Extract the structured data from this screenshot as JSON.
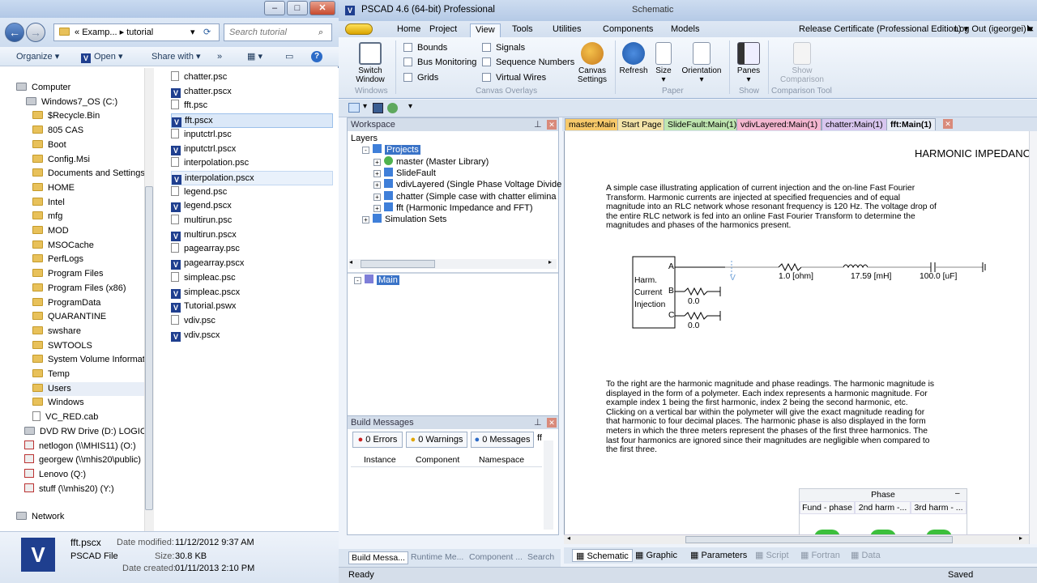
{
  "explorer": {
    "address": {
      "seg1": "Examp...",
      "seg2": "tutorial"
    },
    "search_placeholder": "Search tutorial",
    "commands": {
      "organize": "Organize",
      "open": "Open",
      "share_with": "Share with",
      "more": "»"
    },
    "nav": [
      {
        "label": "Computer",
        "kind": "computer"
      },
      {
        "label": "Windows7_OS (C:)",
        "kind": "drive"
      },
      {
        "label": "$Recycle.Bin",
        "kind": "folder"
      },
      {
        "label": "805 CAS",
        "kind": "folder"
      },
      {
        "label": "Boot",
        "kind": "folder"
      },
      {
        "label": "Config.Msi",
        "kind": "folder"
      },
      {
        "label": "Documents and Settings",
        "kind": "folder"
      },
      {
        "label": "HOME",
        "kind": "folder"
      },
      {
        "label": "Intel",
        "kind": "folder"
      },
      {
        "label": "mfg",
        "kind": "folder"
      },
      {
        "label": "MOD",
        "kind": "folder"
      },
      {
        "label": "MSOCache",
        "kind": "folder"
      },
      {
        "label": "PerfLogs",
        "kind": "folder"
      },
      {
        "label": "Program Files",
        "kind": "folder"
      },
      {
        "label": "Program Files (x86)",
        "kind": "folder"
      },
      {
        "label": "ProgramData",
        "kind": "folder"
      },
      {
        "label": "QUARANTINE",
        "kind": "folder"
      },
      {
        "label": "swshare",
        "kind": "folder"
      },
      {
        "label": "SWTOOLS",
        "kind": "folder"
      },
      {
        "label": "System Volume Informati",
        "kind": "folder"
      },
      {
        "label": "Temp",
        "kind": "folder"
      },
      {
        "label": "Users",
        "kind": "folder"
      },
      {
        "label": "Windows",
        "kind": "folder"
      },
      {
        "label": "VC_RED.cab",
        "kind": "file"
      },
      {
        "label": "DVD RW Drive (D:) LOGICAL",
        "kind": "drive"
      },
      {
        "label": "netlogon (\\\\MHIS11) (O:)",
        "kind": "net"
      },
      {
        "label": "georgew (\\\\mhis20\\public)",
        "kind": "net"
      },
      {
        "label": "Lenovo (Q:)",
        "kind": "net"
      },
      {
        "label": "stuff (\\\\mhis20) (Y:)",
        "kind": "net"
      },
      {
        "label": "Network",
        "kind": "network"
      }
    ],
    "files": [
      {
        "name": "chatter.psc",
        "kind": "doc"
      },
      {
        "name": "chatter.pscx",
        "kind": "pscad"
      },
      {
        "name": "fft.psc",
        "kind": "doc"
      },
      {
        "name": "fft.pscx",
        "kind": "pscad",
        "selected": true
      },
      {
        "name": "inputctrl.psc",
        "kind": "doc"
      },
      {
        "name": "inputctrl.pscx",
        "kind": "pscad"
      },
      {
        "name": "interpolation.psc",
        "kind": "doc"
      },
      {
        "name": "interpolation.pscx",
        "kind": "pscad",
        "hover": true
      },
      {
        "name": "legend.psc",
        "kind": "doc"
      },
      {
        "name": "legend.pscx",
        "kind": "pscad"
      },
      {
        "name": "multirun.psc",
        "kind": "doc"
      },
      {
        "name": "multirun.pscx",
        "kind": "pscad"
      },
      {
        "name": "pagearray.psc",
        "kind": "doc"
      },
      {
        "name": "pagearray.pscx",
        "kind": "pscad"
      },
      {
        "name": "simpleac.psc",
        "kind": "doc"
      },
      {
        "name": "simpleac.pscx",
        "kind": "pscad"
      },
      {
        "name": "Tutorial.pswx",
        "kind": "pscad"
      },
      {
        "name": "vdiv.psc",
        "kind": "doc"
      },
      {
        "name": "vdiv.pscx",
        "kind": "pscad"
      }
    ],
    "details": {
      "name": "fft.pscx",
      "type": "PSCAD File",
      "modified_label": "Date modified:",
      "modified": "11/12/2012 9:37 AM",
      "size_label": "Size:",
      "size": "30.8 KB",
      "created_label": "Date created:",
      "created": "01/11/2013 2:10 PM"
    }
  },
  "pscad": {
    "title": "PSCAD 4.6 (64-bit) Professional",
    "title_center": "Schematic",
    "menu_tabs": [
      "Home",
      "Project",
      "View",
      "Tools",
      "Utilities",
      "Components",
      "Models"
    ],
    "active_tab": "View",
    "release": "Release Certificate (Professional Edition)",
    "logout": "Log Out (igeorgei)",
    "ribbon": {
      "switch_window": [
        "Switch",
        "Window"
      ],
      "windows_group": "Windows",
      "checks": [
        "Bounds",
        "Signals",
        "Bus Monitoring",
        "Sequence Numbers",
        "Grids",
        "Virtual Wires"
      ],
      "canvas_settings": [
        "Canvas",
        "Settings"
      ],
      "canvas_overlays_group": "Canvas Overlays",
      "refresh": "Refresh",
      "size": "Size",
      "orientation": "Orientation",
      "paper_group": "Paper",
      "panes": "Panes",
      "show_group": "Show",
      "show_comparison": [
        "Show",
        "Comparison"
      ],
      "comparison_group": "Comparison Tool"
    },
    "workspace": {
      "title": "Workspace",
      "tree": [
        {
          "label": "Layers",
          "indent": 0
        },
        {
          "label": "Projects",
          "indent": 1,
          "selected": true
        },
        {
          "label": "master (Master Library)",
          "indent": 2
        },
        {
          "label": "SlideFault",
          "indent": 2
        },
        {
          "label": "vdivLayered (Single Phase Voltage Divide",
          "indent": 2
        },
        {
          "label": "chatter (Simple case with chatter elimina",
          "indent": 2
        },
        {
          "label": "fft (Harmonic Impedance and FFT)",
          "indent": 2
        },
        {
          "label": "Simulation Sets",
          "indent": 1
        }
      ],
      "lower_item": "Main"
    },
    "build": {
      "title": "Build Messages",
      "errors": "0 Errors",
      "warnings": "0 Warnings",
      "messages": "0 Messages",
      "extra": "ff",
      "columns": [
        "Instance",
        "Component",
        "Namespace"
      ]
    },
    "bottom_tabs": [
      "Build Messa...",
      "Runtime Me...",
      "Component ...",
      "Search"
    ],
    "doc_tabs": [
      {
        "label": "master:Main",
        "color": "#f7c96a"
      },
      {
        "label": "Start Page",
        "color": "#f3e3a8"
      },
      {
        "label": "SlideFault:Main(1)",
        "color": "#bfe6b0"
      },
      {
        "label": "vdivLayered:Main(1)",
        "color": "#f4b7d0"
      },
      {
        "label": "chatter:Main(1)",
        "color": "#d8c6ef"
      },
      {
        "label": "fft:Main(1)",
        "color": "#e8edf5",
        "active": true
      }
    ],
    "canvas": {
      "heading": "HARMONIC IMPEDANC",
      "para1": [
        "A simple case illustrating application of current injection and the on-line Fast Fourier",
        "Transform.  Harmonic currents are injected at specified frequencies and of equal",
        "magnitude into an RLC network whose resonant frequency is 120 Hz.  The voltage drop of",
        "the entire RLC network is fed into an online Fast Fourier Transform to determine the",
        "magnitudes and phases of the harmonics present."
      ],
      "block": [
        "Harm.",
        "Current",
        "Injection"
      ],
      "ports": [
        "A",
        "B",
        "C"
      ],
      "r_label": "1.0 [ohm]",
      "l_label": "17.59 [mH]",
      "c_label": "100.0 [uF]",
      "v_label": "V",
      "b_value": "0.0",
      "c_value": "0.0",
      "para2": [
        "To the right are the harmonic magnitude and phase readings.  The harmonic magnitude is",
        "displayed in the form of a polymeter.  Each index represents a harmonic magnitude.  For",
        "example index 1 being the first harmonic, index 2 being the second harmonic, etc.",
        "Clicking on a vertical bar within the polymeter will give the exact magnitude reading for",
        "that harmonic to four decimal places.  The harmonic phase is also displayed in the form",
        "meters in which the three meters represent the phases of the first three harmonics.  The",
        "last four harmonics are ignored since their magnitudes are negligible when compared to",
        "the first three."
      ],
      "phase_title": "Phase",
      "phase_cols": [
        "Fund - phase",
        "2nd harm -...",
        "3rd harm - ..."
      ]
    },
    "view_tabs": [
      "Schematic",
      "Graphic",
      "Parameters",
      "Script",
      "Fortran",
      "Data"
    ],
    "status_left": "Ready",
    "status_right": "Saved"
  }
}
